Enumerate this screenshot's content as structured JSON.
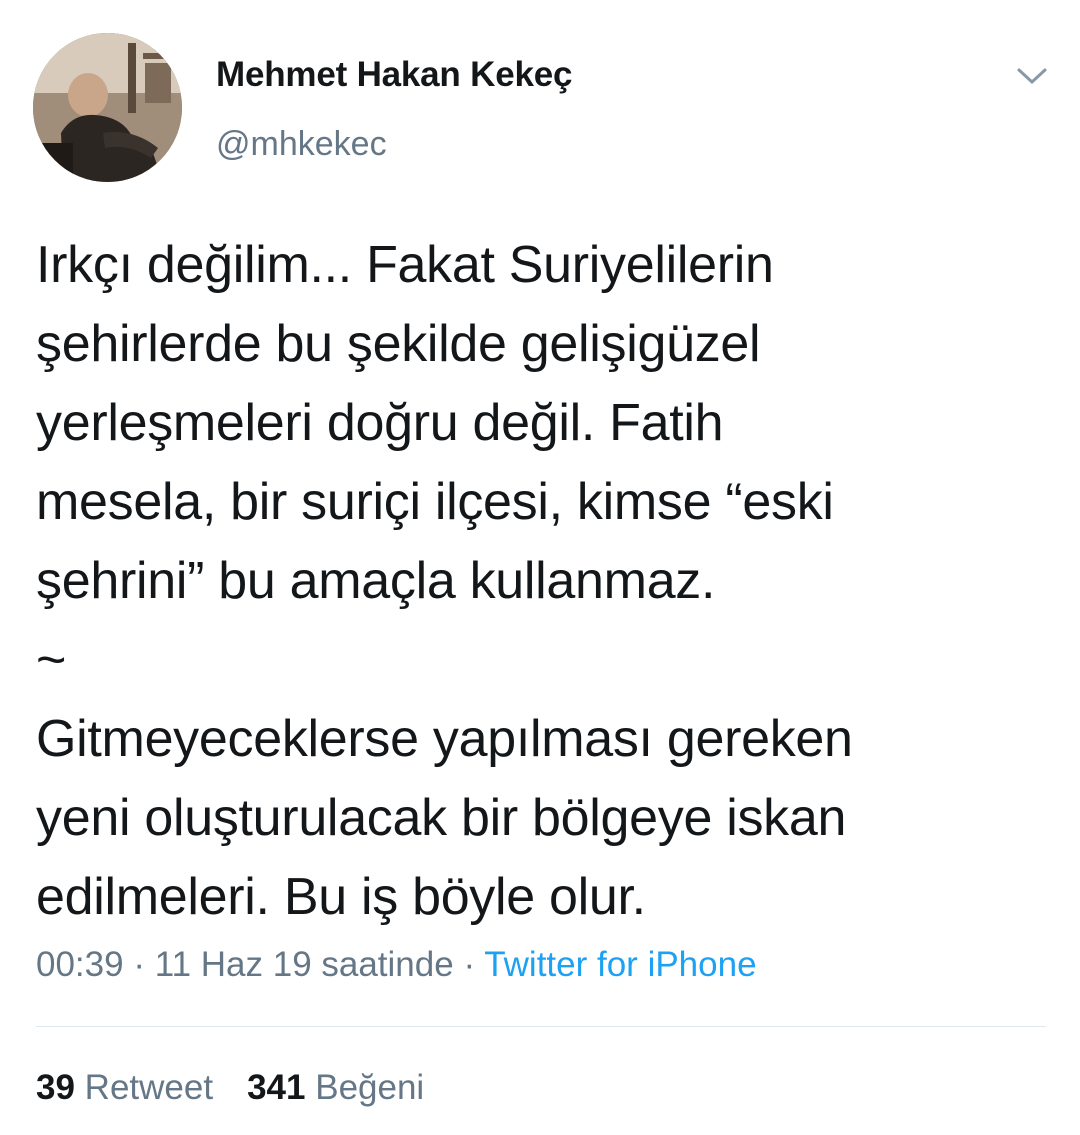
{
  "user": {
    "display_name": "Mehmet Hakan Kekeç",
    "handle": "@mhkekec",
    "avatar_icon": "profile-photo"
  },
  "menu": {
    "icon": "chevron-down-icon"
  },
  "tweet": {
    "lines": [
      "Irkçı değilim... Fakat Suriyelilerin",
      "şehirlerde bu şekilde gelişigüzel",
      "yerleşmeleri doğru değil. Fatih",
      "mesela, bir suriçi ilçesi, kimse “eski",
      "şehrini” bu amaçla kullanmaz.",
      "~",
      "Gitmeyeceklerse yapılması gereken",
      "yeni oluşturulacak bir bölgeye iskan",
      "edilmeleri. Bu iş böyle olur."
    ]
  },
  "meta": {
    "time": "00:39",
    "sep1": " · ",
    "date": "11 Haz 19 saatinde",
    "sep2": " · ",
    "source": "Twitter for iPhone"
  },
  "stats": {
    "retweets_count": "39",
    "retweets_label": "Retweet",
    "likes_count": "341",
    "likes_label": "Beğeni"
  },
  "colors": {
    "text": "#14171a",
    "secondary": "#657786",
    "link": "#1da1f2",
    "divider": "#e1e8ed"
  }
}
